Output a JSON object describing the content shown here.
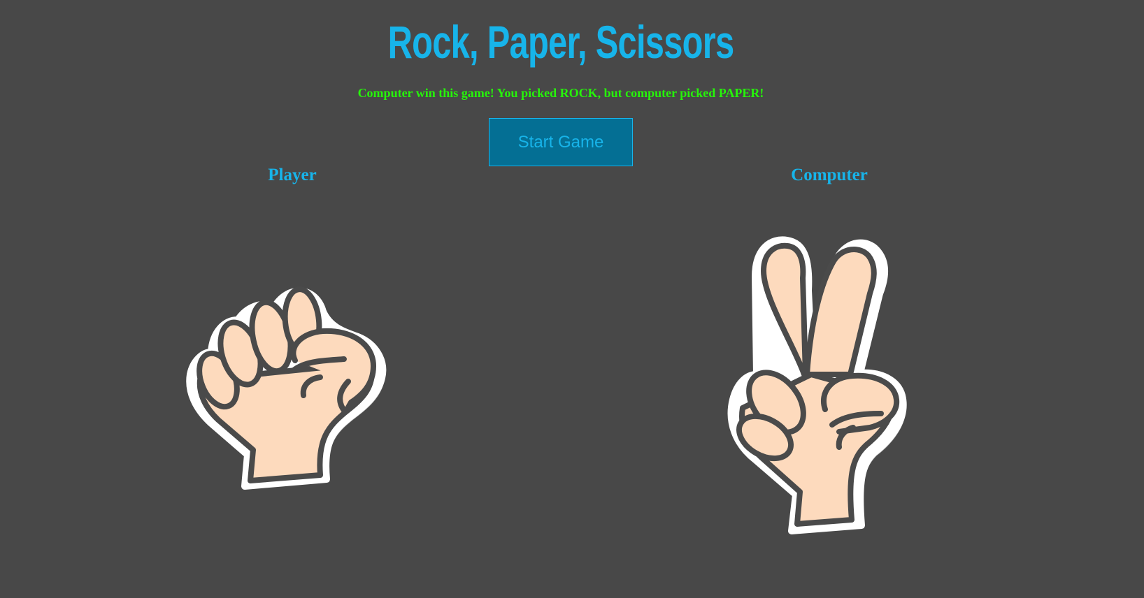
{
  "game": {
    "title": "Rock, Paper, Scissors",
    "result_message": "Computer win this game! You picked ROCK, but computer picked PAPER!",
    "start_button_label": "Start Game"
  },
  "player": {
    "heading": "Player",
    "choice_icon": "rock-fist-icon"
  },
  "computer": {
    "heading": "Computer",
    "choice_icon": "scissors-peace-hand-icon"
  },
  "colors": {
    "background": "#484848",
    "accent": "#17b4ea",
    "result_text": "#26f40a",
    "button_fill": "#046f94",
    "skin": "#fddabd",
    "outline": "#4a4a4a"
  }
}
